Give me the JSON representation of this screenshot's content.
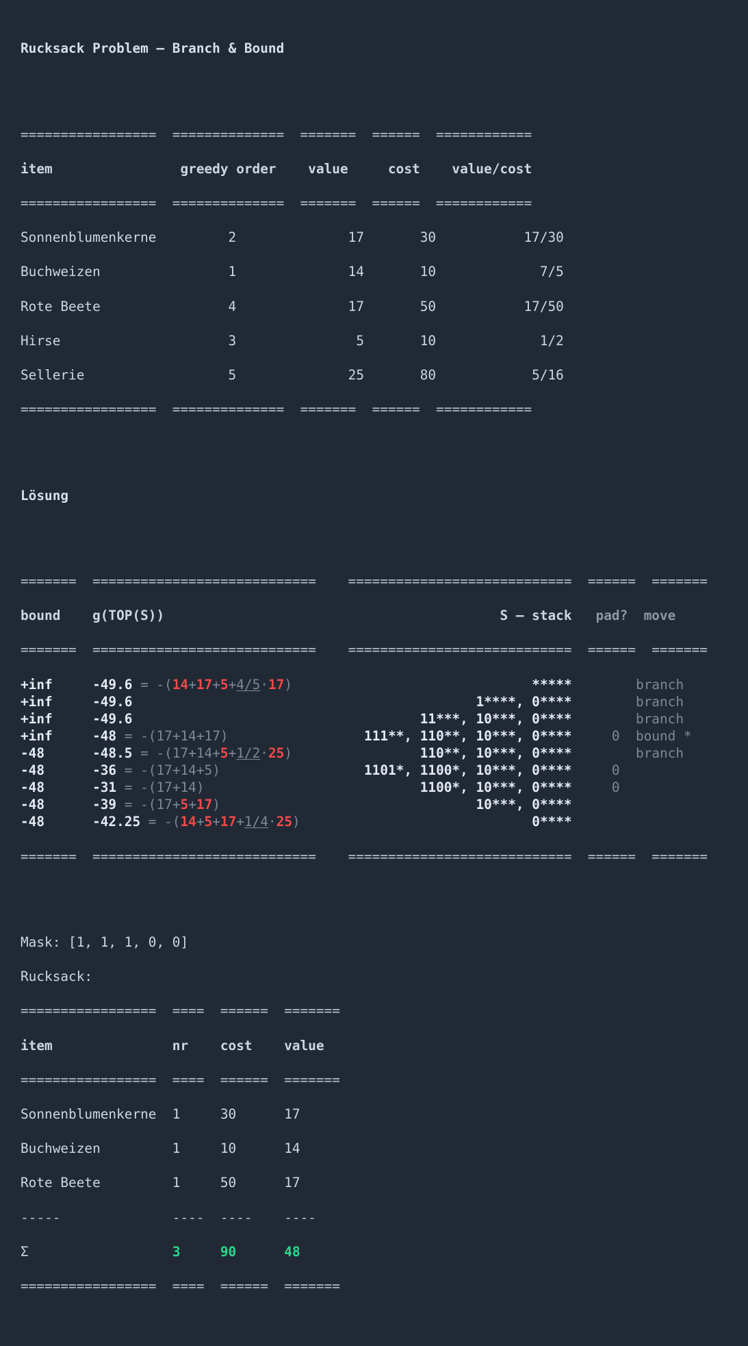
{
  "page": {
    "title": "Rucksack Problem – Branch & Bound",
    "background_color": "#212934",
    "text_color": "#cdd6e3",
    "accent_red": "#f4484a",
    "accent_green": "#27da8e",
    "dim_color": "#7d8899"
  },
  "items_table": {
    "rule_top": "=================  ==============  =======  ======  ============",
    "rule_mid": "=================  ==============  =======  ======  ============",
    "rule_bottom": "=================  ==============  =======  ======  ============",
    "headers": [
      "item",
      "greedy order",
      "value",
      "cost",
      "value/cost"
    ],
    "header_line": "item                greedy order    value     cost    value/cost",
    "rows": [
      {
        "item": "Sonnenblumenkerne",
        "greedy_order": "2",
        "value": "17",
        "cost": "30",
        "value_cost": "17/30",
        "line": "Sonnenblumenkerne         2              17       30           17/30"
      },
      {
        "item": "Buchweizen",
        "greedy_order": "1",
        "value": "14",
        "cost": "10",
        "value_cost": "7/5",
        "line": "Buchweizen                1              14       10             7/5"
      },
      {
        "item": "Rote Beete",
        "greedy_order": "4",
        "value": "17",
        "cost": "50",
        "value_cost": "17/50",
        "line": "Rote Beete                4              17       50           17/50"
      },
      {
        "item": "Hirse",
        "greedy_order": "3",
        "value": "5",
        "cost": "10",
        "value_cost": "1/2",
        "line": "Hirse                     3               5       10             1/2"
      },
      {
        "item": "Sellerie",
        "greedy_order": "5",
        "value": "25",
        "cost": "80",
        "value_cost": "5/16",
        "line": "Sellerie                  5              25       80            5/16"
      }
    ]
  },
  "solution_heading": "Lösung",
  "solution_table": {
    "rule": "=======  ============================    ============================  ======  =======",
    "header_left": "bound    g(TOP(S))",
    "header_stack": "S – stack",
    "header_pad": "pad?",
    "header_move": "move",
    "rows": [
      {
        "bound": "+inf",
        "g_value": "-49.6",
        "g_expr_prefix": " = -(",
        "g_terms": "14+17+5+4/5·17)",
        "stack": "*****",
        "pad": "",
        "move": "branch"
      },
      {
        "bound": "+inf",
        "g_value": "-49.6",
        "g_expr_prefix": "",
        "g_terms": "",
        "stack": "1****, 0****",
        "pad": "",
        "move": "branch"
      },
      {
        "bound": "+inf",
        "g_value": "-49.6",
        "g_expr_prefix": "",
        "g_terms": "",
        "stack": "11***, 10***, 0****",
        "pad": "",
        "move": "branch"
      },
      {
        "bound": "+inf",
        "g_value": "-48",
        "g_expr_prefix": " = -(",
        "g_terms": "17+14+17)",
        "stack": "111**, 110**, 10***, 0****",
        "pad": "0",
        "move": "bound *"
      },
      {
        "bound": "-48",
        "g_value": "-48.5",
        "g_expr_prefix": " = -(",
        "g_terms": "17+14+5+1/2·25)",
        "stack": "110**, 10***, 0****",
        "pad": "",
        "move": "branch"
      },
      {
        "bound": "-48",
        "g_value": "-36",
        "g_expr_prefix": " = -(",
        "g_terms": "17+14+5)",
        "stack": "1101*, 1100*, 10***, 0****",
        "pad": "0",
        "move": ""
      },
      {
        "bound": "-48",
        "g_value": "-31",
        "g_expr_prefix": " = -(",
        "g_terms": "17+14)",
        "stack": "1100*, 10***, 0****",
        "pad": "0",
        "move": ""
      },
      {
        "bound": "-48",
        "g_value": "-39",
        "g_expr_prefix": " = -(",
        "g_terms": "17+5+17)",
        "stack": "10***, 0****",
        "pad": "",
        "move": ""
      },
      {
        "bound": "-48",
        "g_value": "-42.25",
        "g_expr_prefix": " = -(",
        "g_terms": "14+5+17+1/4·25)",
        "stack": "0****",
        "pad": "",
        "move": ""
      }
    ]
  },
  "mask_line": "Mask: [1, 1, 1, 0, 0]",
  "rucksack_label": "Rucksack:",
  "rucksack_table": {
    "rule": "=================  ====  ======  =======",
    "dash_rule": "-----              ----  ----    ----",
    "headers": [
      "item",
      "nr",
      "cost",
      "value"
    ],
    "header_line": "item               nr    cost    value",
    "rows": [
      {
        "item": "Sonnenblumenkerne",
        "nr": "1",
        "cost": "30",
        "value": "17",
        "line": "Sonnenblumenkerne  1     30      17"
      },
      {
        "item": "Buchweizen",
        "nr": "1",
        "cost": "10",
        "value": "14",
        "line": "Buchweizen         1     10      14"
      },
      {
        "item": "Rote Beete",
        "nr": "1",
        "cost": "50",
        "value": "17",
        "line": "Rote Beete         1     50      17"
      }
    ],
    "sum_symbol": "Σ",
    "sum_nr": "3",
    "sum_cost": "90",
    "sum_value": "48"
  }
}
